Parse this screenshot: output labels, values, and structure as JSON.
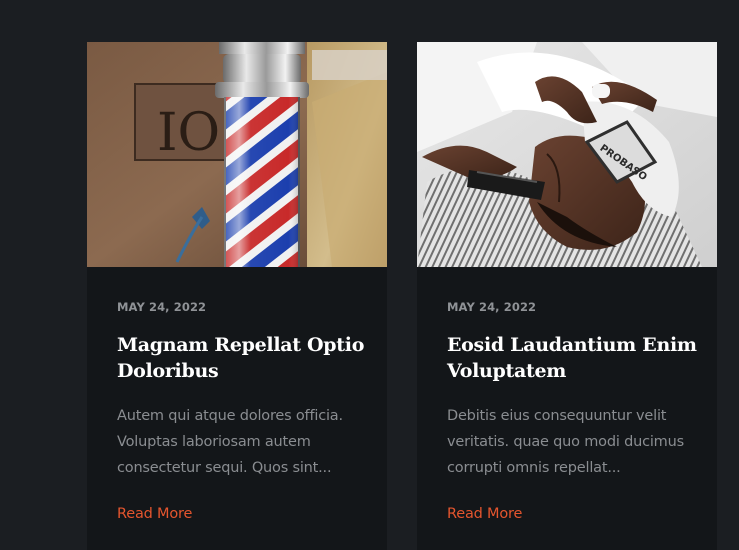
{
  "posts": [
    {
      "date": "MAY 24, 2022",
      "title": "Magnam Repellat Optio Doloribus",
      "excerpt": "Autem qui atque dolores officia. Voluptas laboriosam autem consectetur sequi. Quos sint...",
      "read_more": "Read More",
      "image_label": "IO"
    },
    {
      "date": "MAY 24, 2022",
      "title": "Eosid Laudantium Enim Voluptatem",
      "excerpt": "Debitis eius consequuntur velit veritatis. quae quo modi ducimus corrupti omnis repellat...",
      "read_more": "Read More",
      "image_label": "PROBASO"
    }
  ],
  "colors": {
    "page_bg": "#1b1e22",
    "card_bg": "#131619",
    "accent": "#e4552e",
    "title": "#ffffff",
    "muted": "#8a8d91"
  }
}
